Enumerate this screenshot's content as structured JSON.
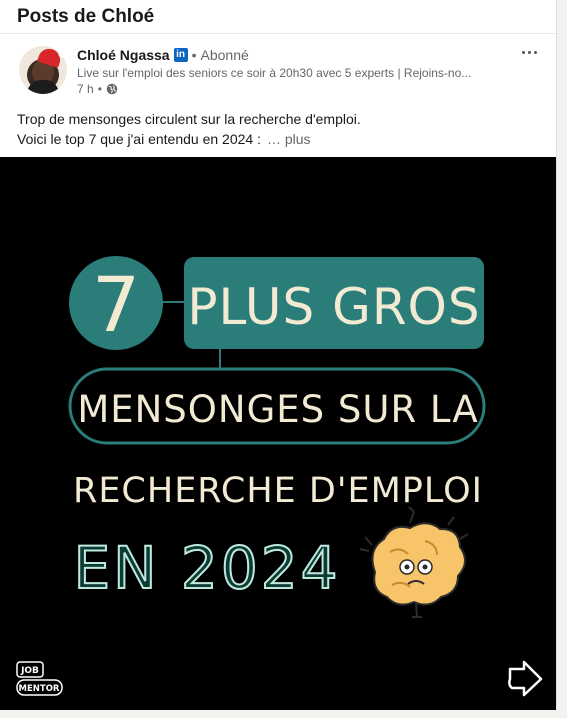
{
  "page": {
    "title": "Posts de Chloé"
  },
  "post": {
    "author": {
      "name": "Chloé Ngassa",
      "badge": "in",
      "separator": "•",
      "follow_status": "Abonné",
      "headline": "Live sur l'emploi des seniors ce soir à 20h30 avec 5 experts | Rejoins-no...",
      "time": "7 h",
      "meta_separator": "•",
      "visibility_icon": "globe-icon"
    },
    "more_icon": "more-horizontal-icon",
    "text_line1": "Trop de mensonges circulent sur la recherche d'emploi.",
    "text_line2": "Voici le top 7 que j'ai entendu en 2024 :",
    "see_more": "… plus",
    "image": {
      "number": "7",
      "line1": "PLUS GROS",
      "line2": "MENSONGES SUR LA",
      "line3": "RECHERCHE D'EMPLOI",
      "line4": "EN 2024",
      "logo_top": "JOB",
      "logo_bottom": "MENTOR",
      "arrow_icon": "swipe-arrow-icon",
      "brain_icon": "stressed-brain-icon",
      "colors": {
        "background": "#000000",
        "teal": "#2a7d79",
        "cream": "#f3ead4",
        "mint": "#bfe8dc",
        "brain": "#f8c46a"
      }
    }
  }
}
